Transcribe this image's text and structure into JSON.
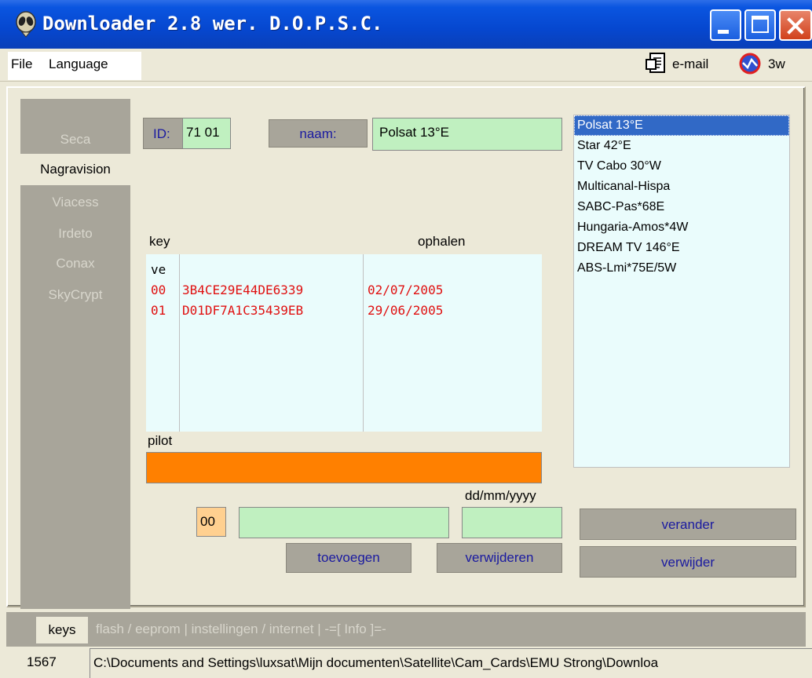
{
  "window": {
    "title": "Downloader 2.8 wer. D.O.P.S.C."
  },
  "menu": {
    "file": "File",
    "language": "Language",
    "email": "e-mail",
    "web": "3w"
  },
  "sidebar": {
    "items": [
      "Seca",
      "Nagravision",
      "Viacess",
      "Irdeto",
      "Conax",
      "SkyCrypt"
    ],
    "active": "Nagravision"
  },
  "fields": {
    "id_label": "ID:",
    "id_value": "71 01",
    "name_label": "naam:",
    "name_value": "Polsat 13°E"
  },
  "keys_table": {
    "col_key": "key",
    "col_fetch": "ophalen",
    "header_row": "ve",
    "rows": [
      {
        "idx": "00",
        "key": "3B4CE29E44DE6339",
        "date": "02/07/2005"
      },
      {
        "idx": "01",
        "key": "D01DF7A1C35439EB",
        "date": "29/06/2005"
      }
    ]
  },
  "pilot": {
    "label": "pilot"
  },
  "entry": {
    "index": "00",
    "date_format": "dd/mm/yyyy"
  },
  "buttons": {
    "add": "toevoegen",
    "remove": "verwijderen",
    "change": "verander",
    "delete": "verwijder"
  },
  "providers": [
    "Polsat 13°E",
    "Star 42°E",
    "TV Cabo 30°W",
    "Multicanal-Hispa",
    "SABC-Pas*68E",
    "Hungaria-Amos*4W",
    "DREAM TV 146°E",
    "ABS-Lmi*75E/5W"
  ],
  "tabs": {
    "active": "keys",
    "others": "flash / eeprom | instellingen / internet | -=[ Info ]=-"
  },
  "status": {
    "count": "1567",
    "path": "C:\\Documents and Settings\\luxsat\\Mijn documenten\\Satellite\\Cam_Cards\\EMU Strong\\Downloa"
  },
  "colors": {
    "titlebar": "#0a55e0",
    "accent_orange": "#ff8000",
    "key_red": "#e01010",
    "selected": "#3169c6"
  }
}
